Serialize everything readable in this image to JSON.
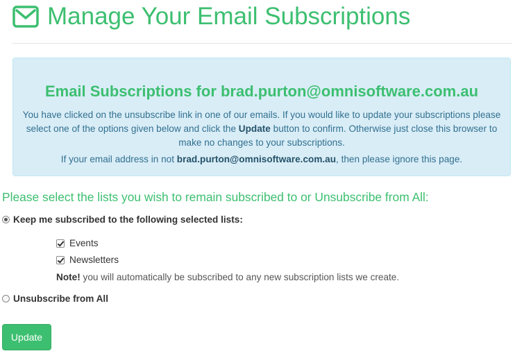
{
  "header": {
    "title": "Manage Your Email Subscriptions",
    "icon": "envelope-icon"
  },
  "info": {
    "heading": "Email Subscriptions for brad.purton@omnisoftware.com.au",
    "text_before": "You have clicked on the unsubscribe link in one of our emails. If you would like to update your subscriptions please select one of the options given below and click the ",
    "text_bold": "Update",
    "text_after": " button to confirm. Otherwise just close this browser to make no changes to your subscriptions.",
    "line2_before": "If your email address in not ",
    "line2_email": "brad.purton@omnisoftware.com.au",
    "line2_after": ", then please ignore this page."
  },
  "form": {
    "prompt": "Please select the lists you wish to remain subscribed to or Unsubscribe from All:",
    "keep_label": "Keep me subscribed to the following selected lists:",
    "keep_selected": true,
    "lists": [
      {
        "label": "Events",
        "checked": true
      },
      {
        "label": "Newsletters",
        "checked": true
      }
    ],
    "note_bold": "Note!",
    "note_text": " you will automatically be subscribed to any new subscription lists we create.",
    "unsubscribe_label": "Unsubscribe from All",
    "unsubscribe_selected": false,
    "update_label": "Update"
  },
  "colors": {
    "accent": "#3cbf70",
    "info_bg": "#d9edf7",
    "info_text": "#31708f"
  }
}
